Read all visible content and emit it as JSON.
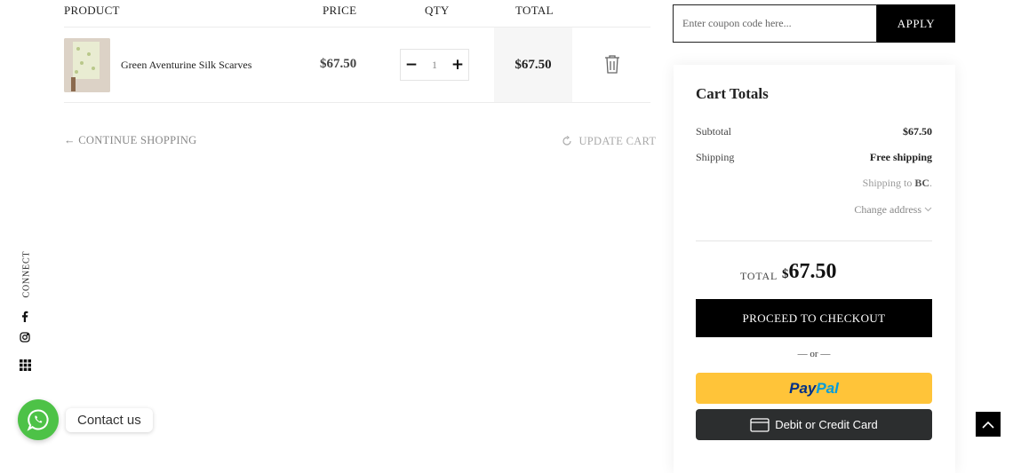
{
  "cart": {
    "headers": {
      "product": "PRODUCT",
      "price": "PRICE",
      "qty": "QTY",
      "total": "TOTAL"
    },
    "items": [
      {
        "name": "Green Aventurine Silk Scarves",
        "price": "$67.50",
        "qty": "1",
        "total": "$67.50"
      }
    ],
    "continue_shopping": "CONTINUE SHOPPING",
    "update_cart": "UPDATE CART"
  },
  "coupon": {
    "placeholder": "Enter coupon code here...",
    "apply_label": "APPLY"
  },
  "totals": {
    "title": "Cart Totals",
    "subtotal_label": "Subtotal",
    "subtotal_value": "$67.50",
    "shipping_label": "Shipping",
    "shipping_value": "Free shipping",
    "shipping_to_prefix": "Shipping to",
    "shipping_to_region": "BC",
    "change_address": "Change address",
    "total_label": "TOTAL",
    "total_currency": "$",
    "total_value": "67.50",
    "checkout_label": "PROCEED TO CHECKOUT",
    "or_text": "— or —",
    "paypal_part1": "Pay",
    "paypal_part2": "Pal",
    "card_button_label": "Debit or Credit Card"
  },
  "social": {
    "connect_label": "CONNECT",
    "icons": [
      "facebook-icon",
      "instagram-icon",
      "grid-icon"
    ]
  },
  "whatsapp": {
    "label": "Contact us"
  },
  "colors": {
    "accent": "#000000",
    "paypal": "#ffc439",
    "whatsapp": "#4dc247",
    "card_button": "#2c2e2f"
  }
}
